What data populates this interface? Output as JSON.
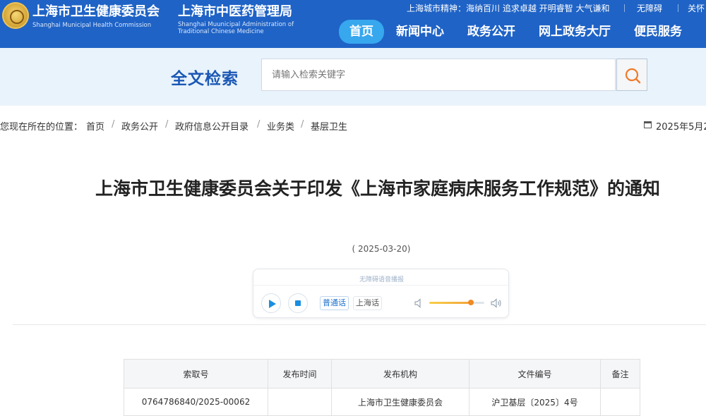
{
  "header": {
    "org1_cn": "上海市卫生健康委员会",
    "org1_en": "Shanghai Municipal Health Commission",
    "org2_cn": "上海市中医药管理局",
    "org2_en_line1": "Shanghai Muunicipal Administration of",
    "org2_en_line2": "Traditional Chinese Medicine",
    "slogan": "上海城市精神：海纳百川 追求卓越 开明睿智 大气谦和",
    "accessibility": "无障碍",
    "care": "关怀",
    "nav": [
      "首页",
      "新闻中心",
      "政务公开",
      "网上政务大厅",
      "便民服务"
    ]
  },
  "search": {
    "title": "全文检索",
    "placeholder": "请输入检索关键字"
  },
  "breadcrumb": {
    "prefix": "您现在所在的位置：",
    "items": [
      "首页",
      "政务公开",
      "政府信息公开目录",
      "业务类",
      "基层卫生"
    ],
    "separator": "/",
    "date": "2025年5月2"
  },
  "article": {
    "title": "上海市卫生健康委员会关于印发《上海市家庭病床服务工作规范》的通知",
    "pubdate": "( 2025-03-20)"
  },
  "player": {
    "caption": "无障碍语音播报",
    "lang_mandarin": "普通话",
    "lang_shanghai": "上海话",
    "volume": 0.75
  },
  "meta_table": {
    "headers": [
      "索取号",
      "发布时间",
      "发布机构",
      "文件编号",
      "备注"
    ],
    "rows": [
      [
        "0764786840/2025-00062",
        "",
        "上海市卫生健康委员会",
        "沪卫基层〔2025〕4号",
        ""
      ]
    ]
  }
}
